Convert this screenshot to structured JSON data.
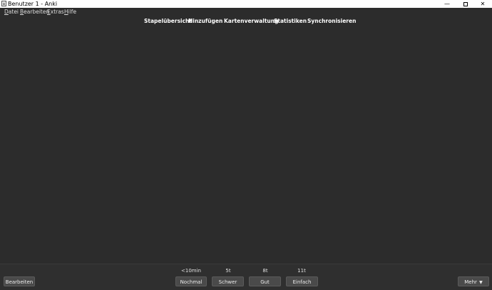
{
  "window": {
    "title": "Benutzer 1 - Anki",
    "minimize_glyph": "—",
    "close_glyph": "✕"
  },
  "menubar": {
    "items": [
      {
        "accel": "D",
        "rest": "atei"
      },
      {
        "accel": "B",
        "rest": "earbeiten"
      },
      {
        "accel": "E",
        "rest": "xtras"
      },
      {
        "accel": "H",
        "rest": "ilfe"
      }
    ]
  },
  "nav": {
    "deck_overview": "Stapelübersicht",
    "add": "Hinzufügen",
    "browse": "Kartenverwaltung",
    "stats": "Statistiken",
    "sync": "Synchronisieren"
  },
  "review": {
    "intervals": {
      "again": "<10min",
      "hard": "5t",
      "good": "8t",
      "easy": "11t"
    },
    "buttons": {
      "edit": "Bearbeiten",
      "again": "Nochmal",
      "hard": "Schwer",
      "good": "Gut",
      "easy": "Einfach",
      "more": "Mehr",
      "more_arrow": "▼"
    }
  }
}
